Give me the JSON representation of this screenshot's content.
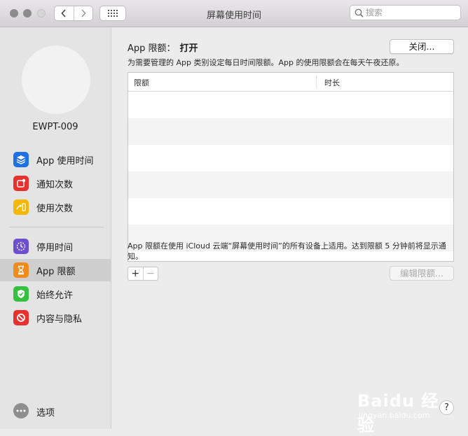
{
  "window": {
    "title": "屏幕使用时间",
    "search_placeholder": "搜索"
  },
  "sidebar": {
    "username": "EWPT-009",
    "items": [
      {
        "label": "App 使用时间",
        "icon": "layers-icon",
        "color": "#1f6fe5"
      },
      {
        "label": "通知次数",
        "icon": "notification-icon",
        "color": "#e8312f"
      },
      {
        "label": "使用次数",
        "icon": "pickup-icon",
        "color": "#f5b700"
      },
      {
        "label": "停用时间",
        "icon": "downtime-icon",
        "color": "#6a4fcf"
      },
      {
        "label": "App 限额",
        "icon": "hourglass-icon",
        "color": "#f08c1c"
      },
      {
        "label": "始终允许",
        "icon": "checkmark-shield-icon",
        "color": "#34c13f"
      },
      {
        "label": "内容与隐私",
        "icon": "prohibited-icon",
        "color": "#e8312f"
      }
    ],
    "options_label": "选项",
    "selected_index": 4
  },
  "main": {
    "status_label": "App 限额：",
    "status_value": "打开",
    "off_button": "关闭...",
    "description": "为需要管理的 App 类别设定每日时间限额。App 的使用限额会在每天午夜还原。",
    "table": {
      "headers": [
        "限额",
        "时长"
      ],
      "rows": []
    },
    "footnote": "App 限额在使用 iCloud 云端“屏幕使用时间”的所有设备上适用。达到限额 5 分钟前将显示通知。",
    "add_button": "+",
    "remove_button": "−",
    "edit_button": "编辑限额...",
    "help_button": "?"
  },
  "watermark": {
    "main": "Baidu 经验",
    "sub": "jingyan.baidu.com"
  }
}
